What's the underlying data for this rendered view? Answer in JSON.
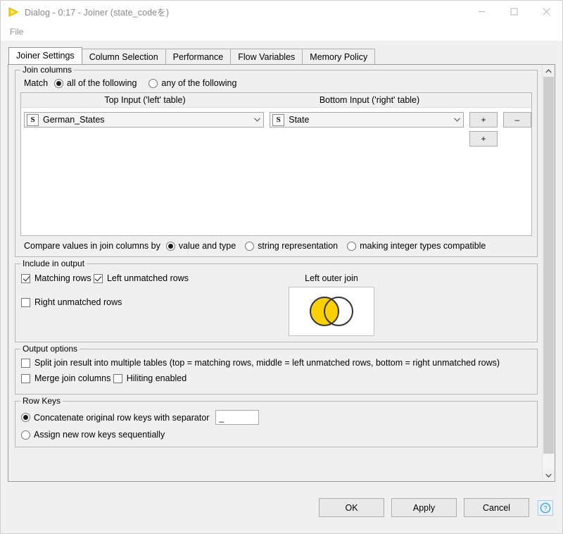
{
  "window": {
    "title": "Dialog - 0:17 - Joiner (state_codeを)",
    "icon": "knime-triangle-icon",
    "minimize_label": "Minimize",
    "maximize_label": "Maximize",
    "close_label": "Close"
  },
  "menubar": {
    "items": [
      {
        "label": "File"
      }
    ]
  },
  "tabs": [
    {
      "label": "Joiner Settings",
      "active": true
    },
    {
      "label": "Column Selection",
      "active": false
    },
    {
      "label": "Performance",
      "active": false
    },
    {
      "label": "Flow Variables",
      "active": false
    },
    {
      "label": "Memory Policy",
      "active": false
    }
  ],
  "join_columns": {
    "legend": "Join columns",
    "match_label": "Match",
    "match_options": [
      {
        "label": "all of the following",
        "selected": true
      },
      {
        "label": "any of the following",
        "selected": false
      }
    ],
    "headers": {
      "left": "Top Input ('left' table)",
      "right": "Bottom Input ('right' table)"
    },
    "rows": [
      {
        "left": {
          "type_badge": "S",
          "value": "German_States"
        },
        "right": {
          "type_badge": "S",
          "value": "State"
        }
      }
    ],
    "add_button_label": "+",
    "remove_button_label": "–",
    "add_row_button_label": "+",
    "compare_label": "Compare values in join columns by",
    "compare_options": [
      {
        "label": "value and type",
        "selected": true
      },
      {
        "label": "string representation",
        "selected": false
      },
      {
        "label": "making integer types compatible",
        "selected": false
      }
    ]
  },
  "include_in_output": {
    "legend": "Include in output",
    "checkboxes": [
      {
        "label": "Matching rows",
        "checked": true
      },
      {
        "label": "Left unmatched rows",
        "checked": true
      },
      {
        "label": "Right unmatched rows",
        "checked": false
      }
    ],
    "diagram_title": "Left outer join",
    "diagram": {
      "name": "venn-left-outer-join",
      "fill_color": "#FAD000",
      "stroke_color": "#333333",
      "left_filled": true,
      "right_filled": false,
      "intersection_filled": true
    }
  },
  "output_options": {
    "legend": "Output options",
    "checkboxes": [
      {
        "label": "Split join result into multiple tables (top = matching rows, middle = left unmatched rows, bottom = right unmatched rows)",
        "checked": false
      },
      {
        "label": "Merge join columns",
        "checked": false
      },
      {
        "label": "Hiliting enabled",
        "checked": false
      }
    ]
  },
  "row_keys": {
    "legend": "Row Keys",
    "options": [
      {
        "label": "Concatenate original row keys with separator",
        "selected": true
      },
      {
        "label": "Assign new row keys sequentially",
        "selected": false
      }
    ],
    "separator_value": "_",
    "separator_placeholder": ""
  },
  "footer": {
    "ok_label": "OK",
    "apply_label": "Apply",
    "cancel_label": "Cancel",
    "help_label": "?"
  },
  "scrollbar": {
    "up_label": "Scroll up",
    "down_label": "Scroll down"
  }
}
